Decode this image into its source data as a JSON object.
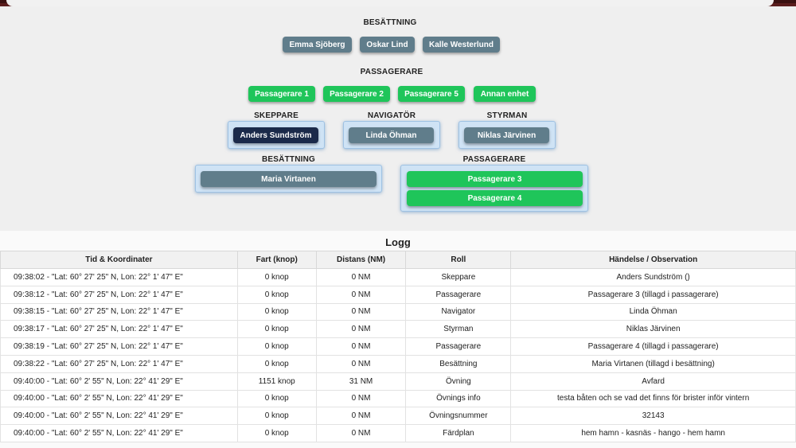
{
  "crew_top": {
    "label": "BESÄTTNING",
    "members": [
      "Emma Sjöberg",
      "Oskar Lind",
      "Kalle Westerlund"
    ]
  },
  "passengers_top": {
    "label": "PASSAGERARE",
    "members": [
      "Passagerare 1",
      "Passagerare 2",
      "Passagerare 5",
      "Annan enhet"
    ]
  },
  "roles": {
    "skeppare": {
      "label": "SKEPPARE",
      "member": "Anders Sundström"
    },
    "navigator": {
      "label": "NAVIGATÖR",
      "member": "Linda Öhman"
    },
    "styrman": {
      "label": "STYRMAN",
      "member": "Niklas Järvinen"
    },
    "besattning": {
      "label": "BESÄTTNING",
      "member": "Maria Virtanen"
    },
    "passagerare": {
      "label": "PASSAGERARE",
      "members": [
        "Passagerare 3",
        "Passagerare 4"
      ]
    }
  },
  "log": {
    "title": "Logg",
    "columns": [
      "Tid & Koordinater",
      "Fart (knop)",
      "Distans (NM)",
      "Roll",
      "Händelse / Observation"
    ],
    "rows": [
      [
        "09:38:02 - \"Lat: 60° 27' 25\" N, Lon: 22° 1' 47\" E\"",
        "0 knop",
        "0 NM",
        "Skeppare",
        "Anders Sundström ()"
      ],
      [
        "09:38:12 - \"Lat: 60° 27' 25\" N, Lon: 22° 1' 47\" E\"",
        "0 knop",
        "0 NM",
        "Passagerare",
        "Passagerare 3 (tillagd i passagerare)"
      ],
      [
        "09:38:15 - \"Lat: 60° 27' 25\" N, Lon: 22° 1' 47\" E\"",
        "0 knop",
        "0 NM",
        "Navigator",
        "Linda Öhman"
      ],
      [
        "09:38:17 - \"Lat: 60° 27' 25\" N, Lon: 22° 1' 47\" E\"",
        "0 knop",
        "0 NM",
        "Styrman",
        "Niklas Järvinen"
      ],
      [
        "09:38:19 - \"Lat: 60° 27' 25\" N, Lon: 22° 1' 47\" E\"",
        "0 knop",
        "0 NM",
        "Passagerare",
        "Passagerare 4 (tillagd i passagerare)"
      ],
      [
        "09:38:22 - \"Lat: 60° 27' 25\" N, Lon: 22° 1' 47\" E\"",
        "0 knop",
        "0 NM",
        "Besättning",
        "Maria Virtanen (tillagd i besättning)"
      ],
      [
        "09:40:00 - \"Lat: 60° 2' 55\" N, Lon: 22° 41' 29\" E\"",
        "1151 knop",
        "31 NM",
        "Övning",
        "Avfard"
      ],
      [
        "09:40:00 - \"Lat: 60° 2' 55\" N, Lon: 22° 41' 29\" E\"",
        "0 knop",
        "0 NM",
        "Övnings info",
        "testa båten och se vad det finns för brister inför vintern"
      ],
      [
        "09:40:00 - \"Lat: 60° 2' 55\" N, Lon: 22° 41' 29\" E\"",
        "0 knop",
        "0 NM",
        "Övningsnummer",
        "32143"
      ],
      [
        "09:40:00 - \"Lat: 60° 2' 55\" N, Lon: 22° 41' 29\" E\"",
        "0 knop",
        "0 NM",
        "Färdplan",
        "hem hamn - kasnäs - hango - hem hamn"
      ]
    ]
  }
}
